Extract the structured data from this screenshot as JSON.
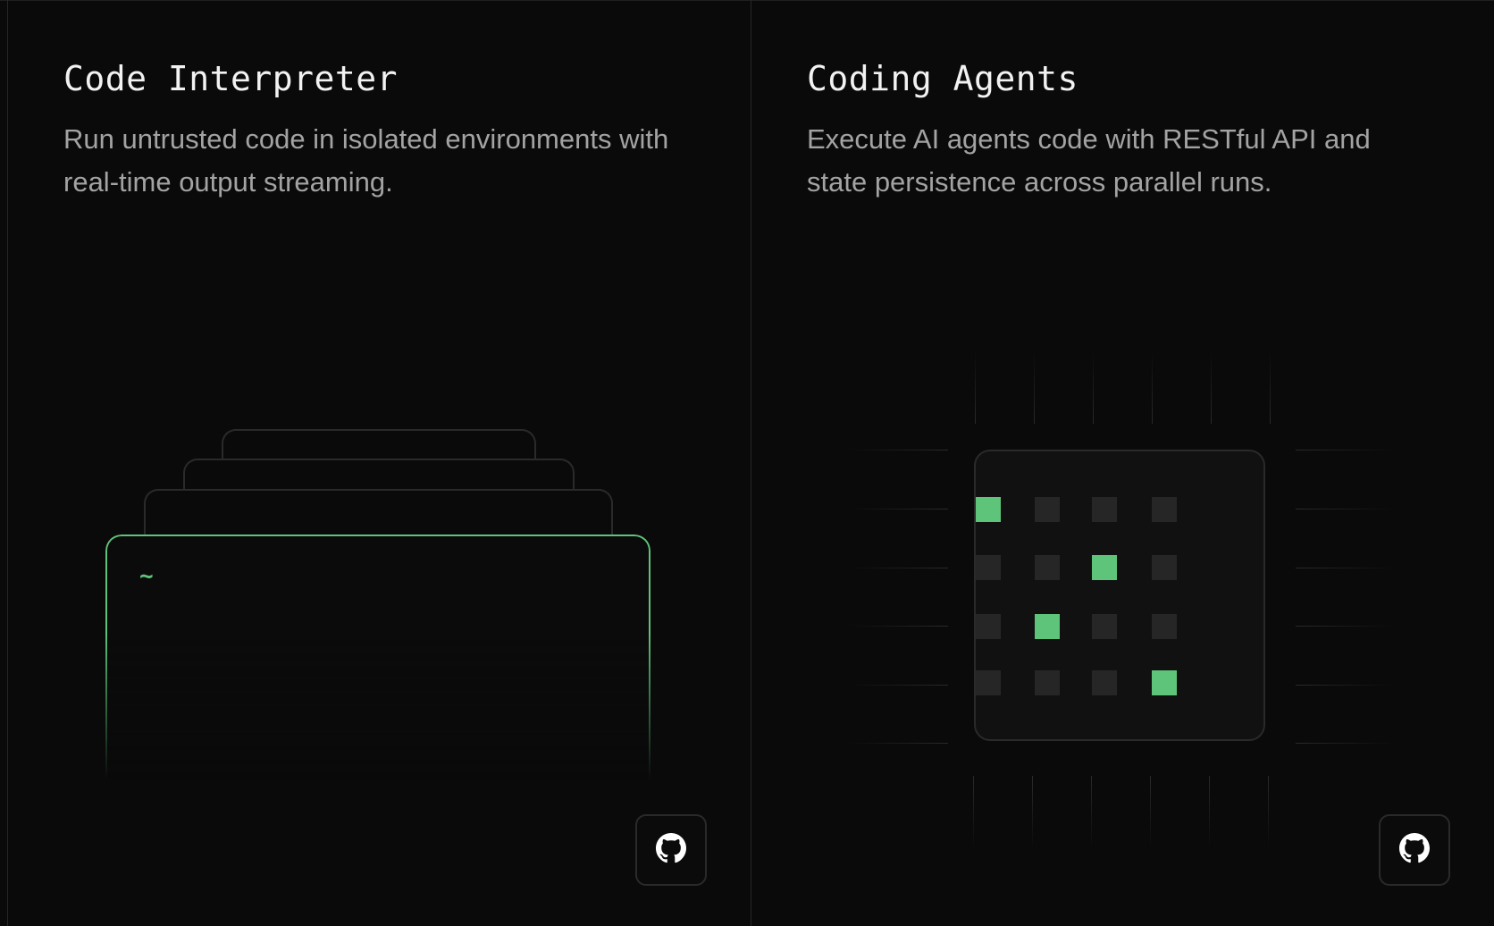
{
  "cards": [
    {
      "title": "Code Interpreter",
      "description": "Run untrusted code in isolated environments with real-time output streaming.",
      "terminal_prompt": "~",
      "link_icon": "github-icon"
    },
    {
      "title": "Coding Agents",
      "description": "Execute AI agents code with RESTful API and state persistence across parallel runs.",
      "link_icon": "github-icon",
      "grid_active": [
        [
          0,
          0
        ],
        [
          1,
          2
        ],
        [
          2,
          1
        ],
        [
          3,
          3
        ]
      ]
    }
  ],
  "colors": {
    "background": "#0a0a0a",
    "accent": "#5ec47a",
    "muted_text": "#a3a3a3",
    "border": "#2a2a2a"
  }
}
